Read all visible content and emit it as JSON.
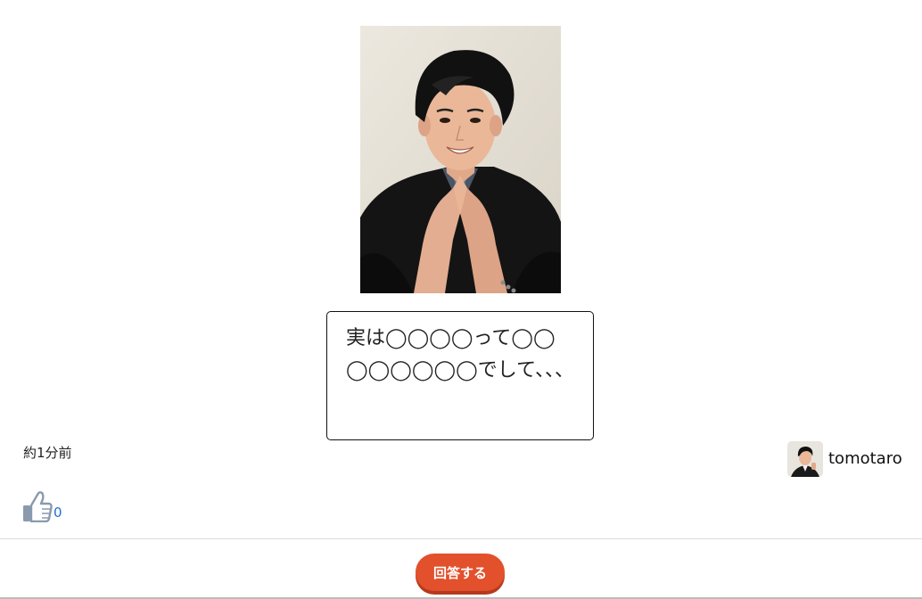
{
  "post": {
    "speech_text": "実は◯◯◯◯って◯◯◯◯◯◯◯◯でして、、、",
    "timestamp": "約1分前"
  },
  "user": {
    "name": "tomotaro"
  },
  "like": {
    "count": "0",
    "icon": "thumbs-up-icon"
  },
  "footer": {
    "answer_label": "回答する"
  },
  "colors": {
    "accent": "#e2502c",
    "link": "#1d6fd8"
  }
}
